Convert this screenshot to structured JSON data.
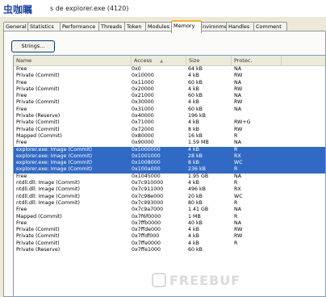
{
  "window": {
    "brand": "虫咖瞩",
    "title": "s de explorer.exe (4120)"
  },
  "tabs": [
    "General",
    "Statistics",
    "Performance",
    "Threads",
    "Token",
    "Modules",
    "Memory",
    "Environment",
    "Handles",
    "Comment"
  ],
  "active_tab_index": 6,
  "strings_button": "Strings...",
  "columns": [
    "Name",
    "Access",
    "Size",
    "Protec."
  ],
  "rows": [
    {
      "name": "Free",
      "access": "0x0",
      "size": "64 kB",
      "prot": "NA"
    },
    {
      "name": "Private (Commit)",
      "access": "0x10000",
      "size": "4 kB",
      "prot": "RW"
    },
    {
      "name": "Free",
      "access": "0x11000",
      "size": "60 kB",
      "prot": "NA"
    },
    {
      "name": "Private (Commit)",
      "access": "0x20000",
      "size": "4 kB",
      "prot": "RW"
    },
    {
      "name": "Free",
      "access": "0x21000",
      "size": "60 kB",
      "prot": "NA"
    },
    {
      "name": "Private (Commit)",
      "access": "0x30000",
      "size": "4 kB",
      "prot": "RW"
    },
    {
      "name": "Free",
      "access": "0x31000",
      "size": "60 kB",
      "prot": "NA"
    },
    {
      "name": "Private (Reserve)",
      "access": "0x40000",
      "size": "196 kB",
      "prot": ""
    },
    {
      "name": "Private (Commit)",
      "access": "0x71000",
      "size": "4 kB",
      "prot": "RW+G"
    },
    {
      "name": "Private (Commit)",
      "access": "0x72000",
      "size": "8 kB",
      "prot": "RW"
    },
    {
      "name": "Mapped (Commit)",
      "access": "0x80000",
      "size": "16 kB",
      "prot": "R"
    },
    {
      "name": "Free",
      "access": "0x90000",
      "size": "1.59 MB",
      "prot": "NA"
    },
    {
      "name": "explorer.exe: Image (Commit)",
      "access": "0x1000000",
      "size": "4 kB",
      "prot": "R",
      "sel": true
    },
    {
      "name": "explorer.exe: Image (Commit)",
      "access": "0x1001000",
      "size": "28 kB",
      "prot": "RX",
      "sel": true
    },
    {
      "name": "explorer.exe: Image (Commit)",
      "access": "0x1008000",
      "size": "8 kB",
      "prot": "WC",
      "sel": true
    },
    {
      "name": "explorer.exe: Image (Commit)",
      "access": "0x100a000",
      "size": "236 kB",
      "prot": "R",
      "sel": true
    },
    {
      "name": "Free",
      "access": "0x1045000",
      "size": "1.95 GB",
      "prot": "NA"
    },
    {
      "name": "ntdll.dll: Image (Commit)",
      "access": "0x7c910000",
      "size": "4 kB",
      "prot": "R"
    },
    {
      "name": "ntdll.dll: Image (Commit)",
      "access": "0x7c911000",
      "size": "496 kB",
      "prot": "RX"
    },
    {
      "name": "ntdll.dll: Image (Commit)",
      "access": "0x7c98e000",
      "size": "20 kB",
      "prot": "WC"
    },
    {
      "name": "ntdll.dll: Image (Commit)",
      "access": "0x7c993000",
      "size": "80 kB",
      "prot": "R"
    },
    {
      "name": "Free",
      "access": "0x7c9a7000",
      "size": "1.41 GB",
      "prot": "NA"
    },
    {
      "name": "Mapped (Commit)",
      "access": "0x7f6f0000",
      "size": "1 MB",
      "prot": "R"
    },
    {
      "name": "Free",
      "access": "0x7ffb0000",
      "size": "40 kB",
      "prot": "NA"
    },
    {
      "name": "Private (Commit)",
      "access": "0x7ffde000",
      "size": "4 kB",
      "prot": "RW"
    },
    {
      "name": "Private (Commit)",
      "access": "0x7ffdf000",
      "size": "4 kB",
      "prot": "RW"
    },
    {
      "name": "Private (Commit)",
      "access": "0x7ffe0000",
      "size": "4 kB",
      "prot": "R"
    },
    {
      "name": "Private (Reserve)",
      "access": "0x7ffe1000",
      "size": "60 kB",
      "prot": ""
    }
  ],
  "watermark": "FREEBUF"
}
